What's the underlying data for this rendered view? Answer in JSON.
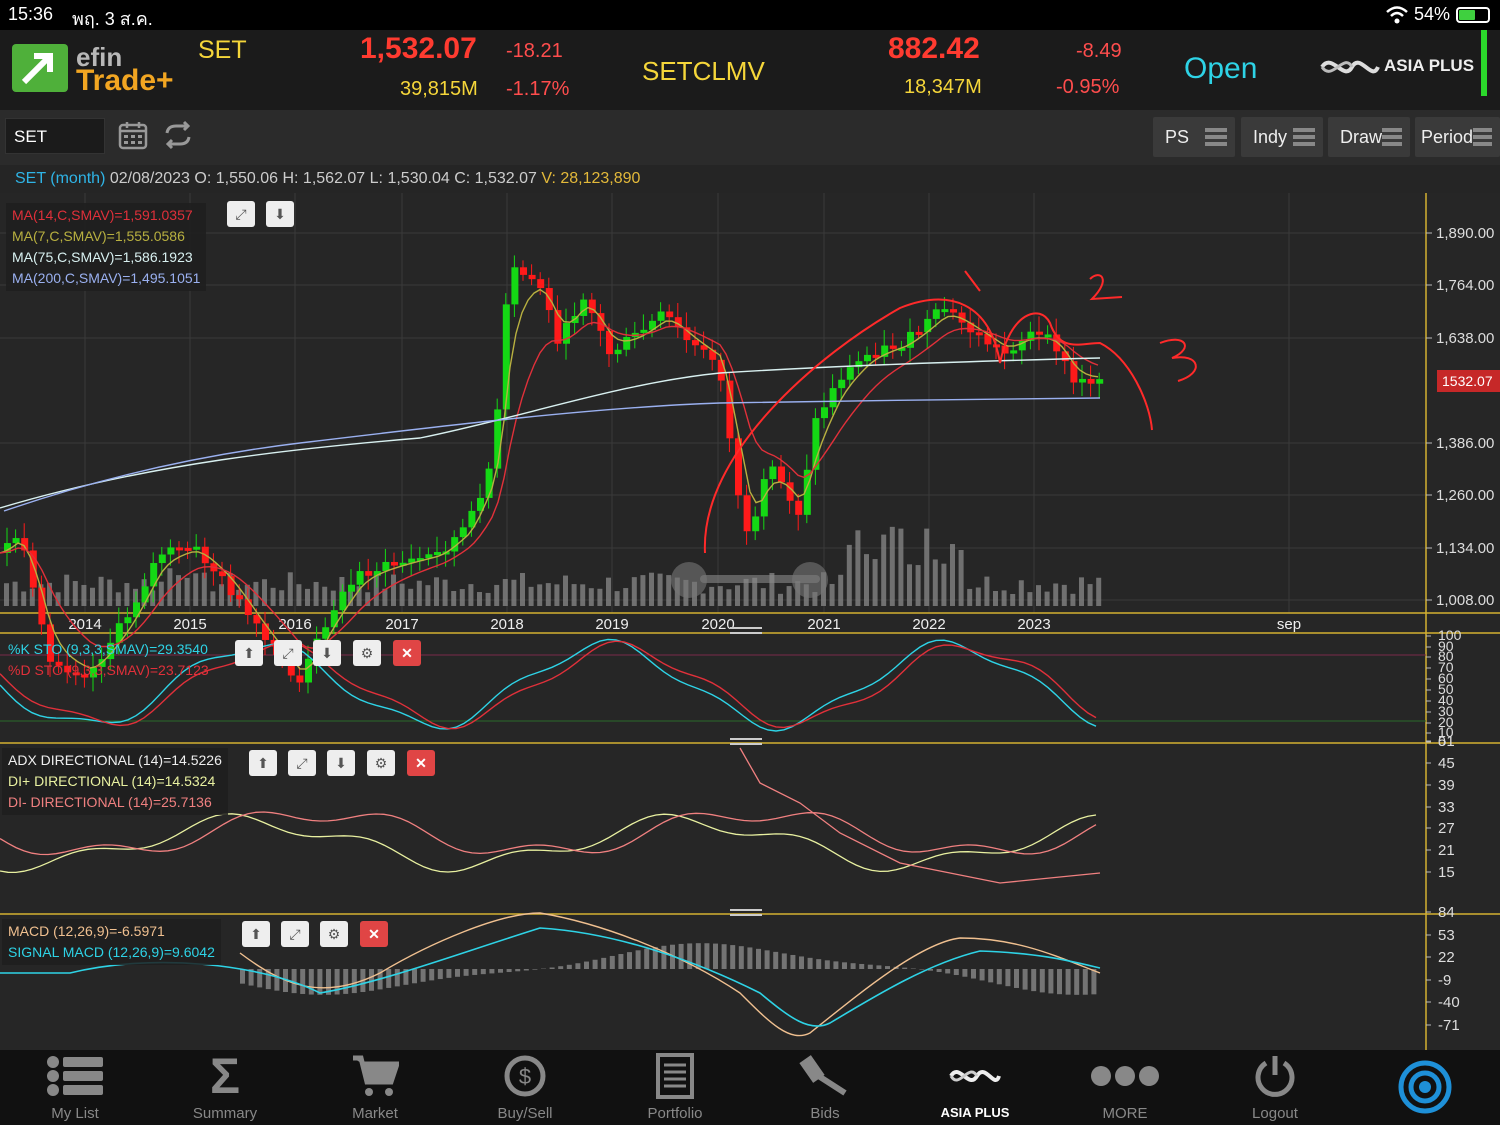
{
  "status_bar": {
    "time": "15:36",
    "date": "พฤ. 3 ส.ค.",
    "battery": "54%"
  },
  "header": {
    "logo_top": "efin",
    "logo_bottom": "Trade+",
    "index1": {
      "name": "SET",
      "value": "1,532.07",
      "change": "-18.21",
      "volume": "39,815M",
      "pct": "-1.17%"
    },
    "index2": {
      "name": "SETCLMV",
      "value": "882.42",
      "change": "-8.49",
      "volume": "18,347M",
      "pct": "-0.95%"
    },
    "market_status": "Open",
    "broker": "ASIA PLUS"
  },
  "toolbar": {
    "symbol": "SET",
    "ps": "PS",
    "indy": "Indy",
    "draw": "Draw",
    "period": "Period"
  },
  "info": {
    "label": "SET (month)",
    "date": "02/08/2023",
    "o_lbl": "O:",
    "o": "1,550.06",
    "h_lbl": "H:",
    "h": "1,562.07",
    "l_lbl": "L:",
    "l": "1,530.04",
    "c_lbl": "C:",
    "c": "1,532.07",
    "v_lbl": "V:",
    "v": "28,123,890"
  },
  "price_panel": {
    "legend": [
      {
        "text": "MA(14,C,SMAV)=1,591.0357",
        "color": "#e0303a"
      },
      {
        "text": "MA(7,C,SMAV)=1,555.0586",
        "color": "#b8b040"
      },
      {
        "text": "MA(75,C,SMAV)=1,586.1923",
        "color": "#d8f0f0"
      },
      {
        "text": "MA(200,C,SMAV)=1,495.1051",
        "color": "#9ab0f0"
      }
    ],
    "y_ticks": [
      "1,890.00",
      "1,764.00",
      "1,638.00",
      "1,386.00",
      "1,260.00",
      "1,134.00",
      "1,008.00"
    ],
    "price_tag": "1532.07",
    "x_labels": [
      "2014",
      "2015",
      "2016",
      "2017",
      "2018",
      "2019",
      "2020",
      "2021",
      "2022",
      "2023",
      "sep"
    ]
  },
  "sto_panel": {
    "legend": [
      {
        "text": "%K STO (9,3,3,SMAV)=29.3540",
        "color": "#2ed3e6"
      },
      {
        "text": "%D STO (9,3,3,SMAV)=23.7123",
        "color": "#e0303a"
      }
    ],
    "y_ticks": [
      "100",
      "90",
      "80",
      "70",
      "60",
      "50",
      "40",
      "30",
      "20",
      "10",
      "0"
    ]
  },
  "adx_panel": {
    "legend": [
      {
        "text": "ADX DIRECTIONAL (14)=14.5226",
        "color": "#eeeeee"
      },
      {
        "text": "DI+ DIRECTIONAL (14)=14.5324",
        "color": "#e8f0a0"
      },
      {
        "text": "DI- DIRECTIONAL (14)=25.7136",
        "color": "#f08080"
      }
    ],
    "y_ticks": [
      "51",
      "45",
      "39",
      "33",
      "27",
      "21",
      "15"
    ]
  },
  "macd_panel": {
    "legend": [
      {
        "text": "MACD (12,26,9)=-6.5971",
        "color": "#f0c090"
      },
      {
        "text": "SIGNAL MACD (12,26,9)=9.6042",
        "color": "#2ed3e6"
      }
    ],
    "y_ticks": [
      "84",
      "53",
      "22",
      "-9",
      "-40",
      "-71"
    ]
  },
  "nav": {
    "items": [
      {
        "label": "My List",
        "icon": "list-icon"
      },
      {
        "label": "Summary",
        "icon": "sigma-icon"
      },
      {
        "label": "Market",
        "icon": "cart-icon"
      },
      {
        "label": "Buy/Sell",
        "icon": "dollar-icon"
      },
      {
        "label": "Portfolio",
        "icon": "document-icon"
      },
      {
        "label": "Bids",
        "icon": "gavel-icon"
      },
      {
        "label": "ASIA PLUS",
        "icon": "asiaplus-icon"
      },
      {
        "label": "MORE",
        "icon": "more-icon"
      },
      {
        "label": "Logout",
        "icon": "power-icon"
      }
    ]
  },
  "colors": {
    "up": "#14d814",
    "down": "#ff1a1a",
    "accent": "#2ed3e6",
    "grid_divider": "#d4b030"
  }
}
